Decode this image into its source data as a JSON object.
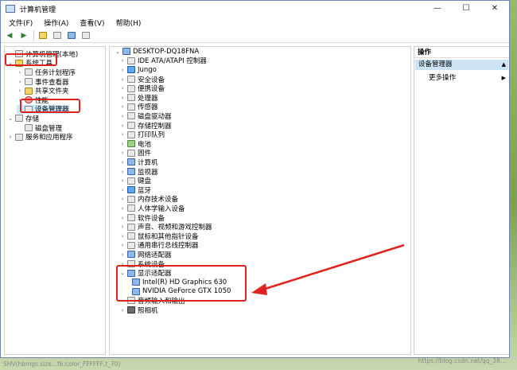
{
  "window": {
    "title": "计算机管理",
    "controls": [
      "—",
      "☐",
      "✕"
    ]
  },
  "menu": [
    "文件(F)",
    "操作(A)",
    "查看(V)",
    "帮助(H)"
  ],
  "left_tree": [
    {
      "label": "计算机管理(本地)",
      "indent": 0,
      "arrow": "",
      "icon": "c"
    },
    {
      "label": "系统工具",
      "indent": 0,
      "arrow": "⌄",
      "icon": "y"
    },
    {
      "label": "任务计划程序",
      "indent": 2,
      "arrow": "›",
      "icon": "c"
    },
    {
      "label": "事件查看器",
      "indent": 2,
      "arrow": "›",
      "icon": "c"
    },
    {
      "label": "共享文件夹",
      "indent": 2,
      "arrow": "›",
      "icon": "y"
    },
    {
      "label": "性能",
      "indent": 2,
      "arrow": "›",
      "icon": "r"
    },
    {
      "label": "设备管理器",
      "indent": 2,
      "arrow": "",
      "icon": "c"
    },
    {
      "label": "存储",
      "indent": 0,
      "arrow": "⌄",
      "icon": "c"
    },
    {
      "label": "磁盘管理",
      "indent": 2,
      "arrow": "",
      "icon": "c"
    },
    {
      "label": "服务和应用程序",
      "indent": 0,
      "arrow": "›",
      "icon": "c"
    }
  ],
  "device_tree": [
    {
      "label": "DESKTOP-DQ18FNA",
      "indent": 0,
      "arrow": "⌄",
      "icon": "b"
    },
    {
      "label": "IDE ATA/ATAPI 控制器",
      "indent": 1,
      "arrow": "›",
      "icon": "c"
    },
    {
      "label": "Jungo",
      "indent": 1,
      "arrow": "›",
      "icon": "m"
    },
    {
      "label": "安全设备",
      "indent": 1,
      "arrow": "›",
      "icon": "c"
    },
    {
      "label": "便携设备",
      "indent": 1,
      "arrow": "›",
      "icon": "c"
    },
    {
      "label": "处理器",
      "indent": 1,
      "arrow": "›",
      "icon": "c"
    },
    {
      "label": "传感器",
      "indent": 1,
      "arrow": "›",
      "icon": "c"
    },
    {
      "label": "磁盘驱动器",
      "indent": 1,
      "arrow": "›",
      "icon": "c"
    },
    {
      "label": "存储控制器",
      "indent": 1,
      "arrow": "›",
      "icon": "c"
    },
    {
      "label": "打印队列",
      "indent": 1,
      "arrow": "›",
      "icon": "c"
    },
    {
      "label": "电池",
      "indent": 1,
      "arrow": "›",
      "icon": "g"
    },
    {
      "label": "固件",
      "indent": 1,
      "arrow": "›",
      "icon": "c"
    },
    {
      "label": "计算机",
      "indent": 1,
      "arrow": "›",
      "icon": "b"
    },
    {
      "label": "监视器",
      "indent": 1,
      "arrow": "›",
      "icon": "b"
    },
    {
      "label": "键盘",
      "indent": 1,
      "arrow": "›",
      "icon": "c"
    },
    {
      "label": "蓝牙",
      "indent": 1,
      "arrow": "›",
      "icon": "m"
    },
    {
      "label": "内存技术设备",
      "indent": 1,
      "arrow": "›",
      "icon": "c"
    },
    {
      "label": "人体学输入设备",
      "indent": 1,
      "arrow": "›",
      "icon": "c"
    },
    {
      "label": "软件设备",
      "indent": 1,
      "arrow": "›",
      "icon": "c"
    },
    {
      "label": "声音、视频和游戏控制器",
      "indent": 1,
      "arrow": "›",
      "icon": "c"
    },
    {
      "label": "鼠标和其他指针设备",
      "indent": 1,
      "arrow": "›",
      "icon": "c"
    },
    {
      "label": "通用串行总线控制器",
      "indent": 1,
      "arrow": "›",
      "icon": "c"
    },
    {
      "label": "网络适配器",
      "indent": 1,
      "arrow": "›",
      "icon": "b"
    },
    {
      "label": "系统设备",
      "indent": 1,
      "arrow": "›",
      "icon": "c"
    },
    {
      "label": "显示适配器",
      "indent": 1,
      "arrow": "⌄",
      "icon": "b"
    },
    {
      "label": "Intel(R) HD Graphics 630",
      "indent": 2,
      "arrow": "",
      "icon": "b"
    },
    {
      "label": "NVIDIA GeForce GTX 1050",
      "indent": 2,
      "arrow": "",
      "icon": "b"
    },
    {
      "label": "音频输入和输出",
      "indent": 1,
      "arrow": "›",
      "icon": "c"
    },
    {
      "label": "照相机",
      "indent": 1,
      "arrow": "›",
      "icon": "k"
    }
  ],
  "actions": {
    "header": "操作",
    "selected": "设备管理器",
    "more": "更多操作"
  },
  "statusbar": "SHV(hbmgs.size...f6.color_FFFFFF,t_70)",
  "watermark": "https://blog.csdn.net/qq_38..."
}
